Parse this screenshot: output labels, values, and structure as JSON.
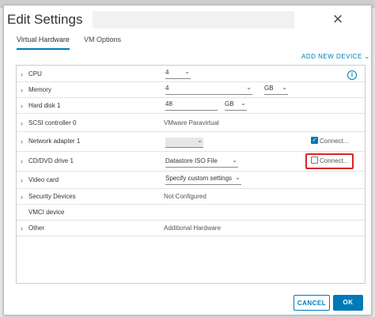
{
  "colors": {
    "accent": "#0079b8",
    "highlight": "#dd2222"
  },
  "dialog": {
    "title": "Edit Settings",
    "close_icon": "close-icon"
  },
  "tabs": [
    {
      "label": "Virtual Hardware",
      "active": true
    },
    {
      "label": "VM Options",
      "active": false
    }
  ],
  "add_device": "ADD NEW DEVICE ⌄",
  "info_icon": "i",
  "rows": {
    "cpu": {
      "label": "CPU",
      "value": "4"
    },
    "memory": {
      "label": "Memory",
      "value": "4",
      "unit": "GB"
    },
    "hard_disk": {
      "label": "Hard disk 1",
      "value": "48",
      "unit": "GB"
    },
    "scsi": {
      "label": "SCSI controller 0",
      "value": "VMware Paravirtual"
    },
    "network": {
      "label": "Network adapter 1",
      "value": "",
      "connect_label": "Connect...",
      "connected": true
    },
    "cdrom": {
      "label": "CD/DVD drive 1",
      "value": "Datastore ISO File",
      "connect_label": "Connect...",
      "connected": false
    },
    "video": {
      "label": "Video card",
      "value": "Specify custom settings"
    },
    "security": {
      "label": "Security Devices",
      "value": "Not Configured"
    },
    "vmci": {
      "label": "VMCI device"
    },
    "other": {
      "label": "Other",
      "value": "Additional Hardware"
    }
  },
  "buttons": {
    "cancel": "CANCEL",
    "ok": "OK"
  }
}
